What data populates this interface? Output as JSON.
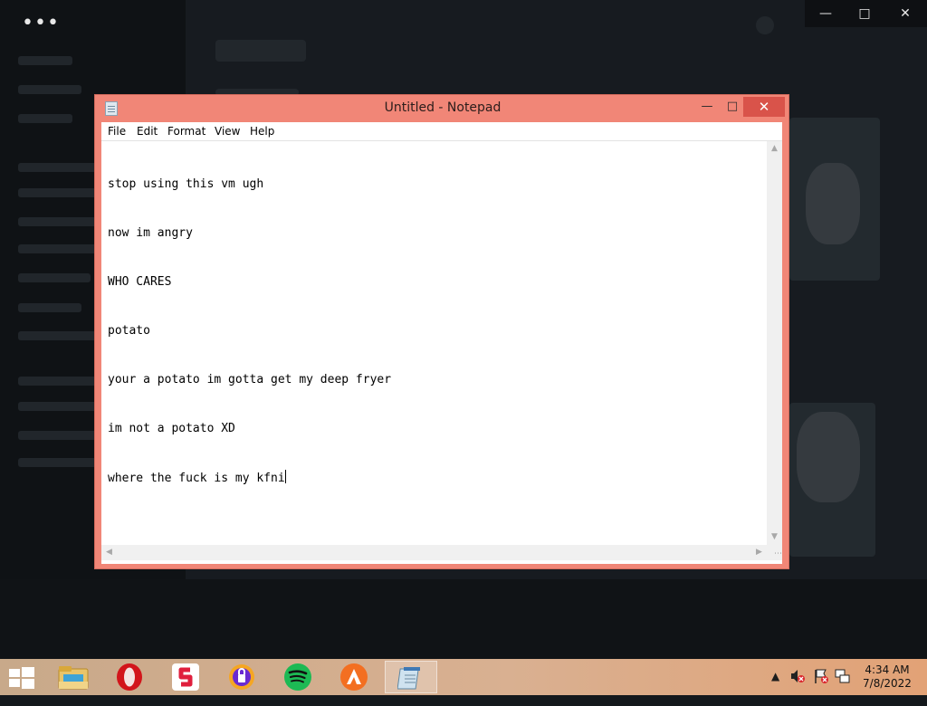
{
  "notepad": {
    "title": "Untitled - Notepad",
    "menu": [
      "File",
      "Edit",
      "Format",
      "View",
      "Help"
    ],
    "lines": [
      "stop using this vm ugh",
      "now im angry",
      "WHO CARES",
      "potato",
      "your a potato im gotta get my deep fryer",
      "im not a potato XD",
      "where the fuck is my kfni"
    ]
  },
  "background_window": {
    "controls": [
      "minimize",
      "maximize",
      "close"
    ]
  },
  "taskbar": {
    "apps": [
      {
        "name": "file-explorer"
      },
      {
        "name": "opera"
      },
      {
        "name": "sejda"
      },
      {
        "name": "vpn"
      },
      {
        "name": "spotify"
      },
      {
        "name": "avast"
      },
      {
        "name": "notepad",
        "active": true
      }
    ],
    "clock": {
      "time": "4:34 AM",
      "date": "7/8/2022"
    }
  },
  "colors": {
    "notepad_frame": "#f18677",
    "taskbar_start": "#c8a98a",
    "taskbar_end": "#e2a276",
    "spotify_green": "#1db954",
    "opera_red": "#d2151b"
  }
}
